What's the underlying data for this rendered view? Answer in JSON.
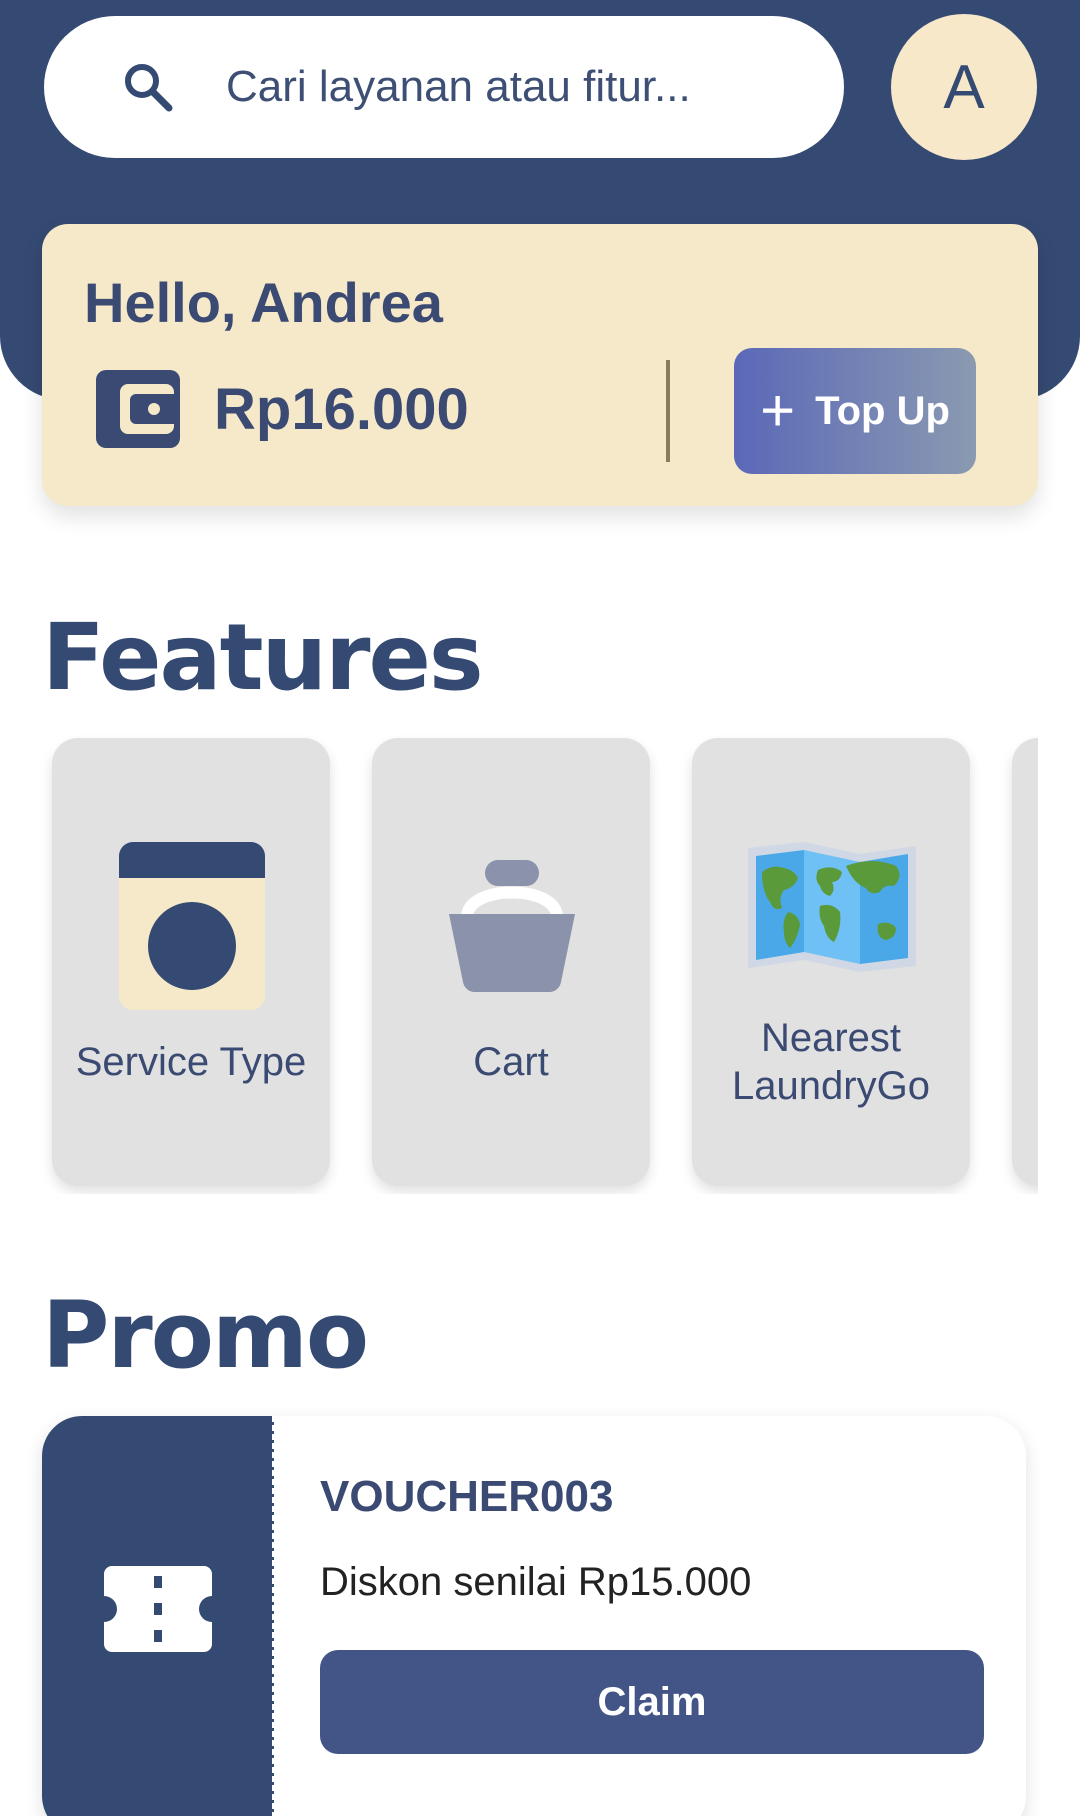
{
  "header": {
    "search": {
      "placeholder": "Cari layanan atau fitur..."
    },
    "avatar_initial": "A"
  },
  "balance_card": {
    "greeting": "Hello, Andrea",
    "balance": "Rp16.000",
    "topup_label": "Top Up"
  },
  "features": {
    "title": "Features",
    "items": [
      {
        "label": "Service Type",
        "icon": "washing-machine-icon"
      },
      {
        "label": "Cart",
        "icon": "basket-icon"
      },
      {
        "label_line1": "Nearest",
        "label_line2": "LaundryGo",
        "icon": "world-map-icon"
      }
    ]
  },
  "promo": {
    "title": "Promo",
    "voucher": {
      "code": "VOUCHER003",
      "description": "Diskon senilai Rp15.000",
      "claim_label": "Claim",
      "icon": "ticket-icon"
    }
  },
  "colors": {
    "primary": "#354a72",
    "cream": "#f6e9ca",
    "card_grey": "#e1e1e1",
    "button": "#435587"
  }
}
